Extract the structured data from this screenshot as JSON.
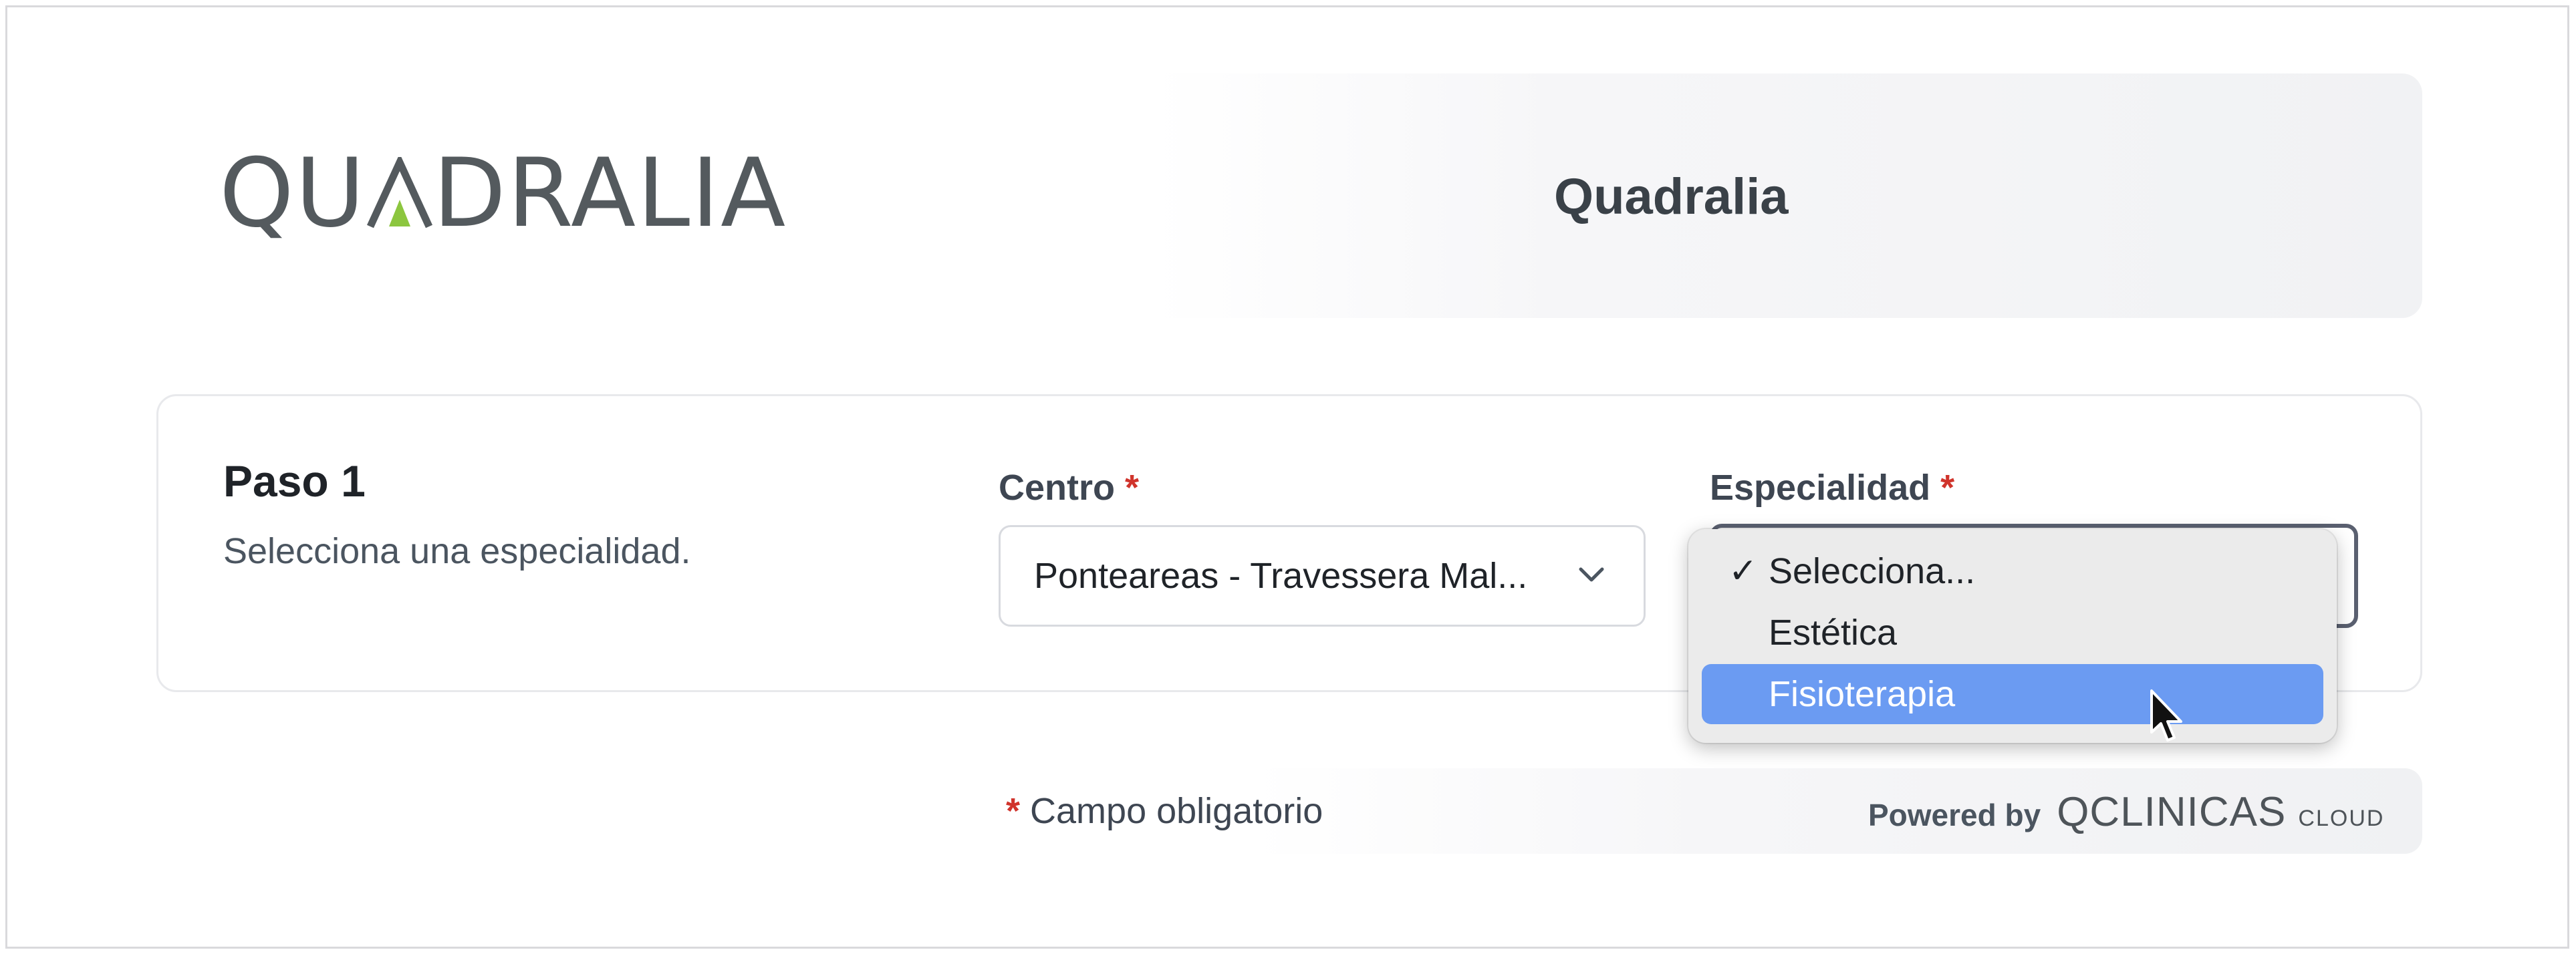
{
  "header": {
    "logo_text_before": "QU",
    "logo_text_after": "DRALIA",
    "logo_accent_color": "#8cc63f",
    "title": "Quadralia"
  },
  "step": {
    "title": "Paso 1",
    "description": "Selecciona una especialidad."
  },
  "centro": {
    "label": "Centro",
    "required_mark": "*",
    "value": "Ponteareas - Travessera Mal..."
  },
  "especialidad": {
    "label": "Especialidad",
    "required_mark": "*",
    "options": [
      {
        "label": "Selecciona...",
        "checked": true,
        "highlighted": false
      },
      {
        "label": "Estética",
        "checked": false,
        "highlighted": false
      },
      {
        "label": "Fisioterapia",
        "checked": false,
        "highlighted": true
      }
    ],
    "check_glyph": "✓",
    "highlight_color": "#6b9bf2"
  },
  "footer": {
    "required_mark": "*",
    "required_note": "Campo obligatorio",
    "powered_by": "Powered by",
    "brand_name": "QCLINICAS",
    "brand_suffix": "CLOUD"
  },
  "colors": {
    "required": "#d0342c",
    "text_dark": "#1f2328"
  }
}
